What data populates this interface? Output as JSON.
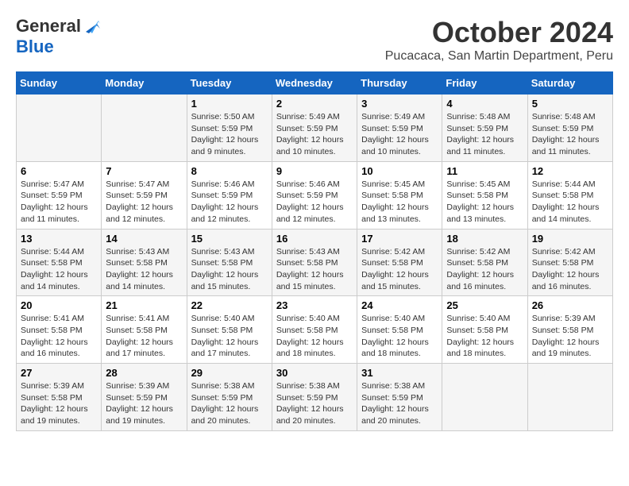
{
  "logo": {
    "general": "General",
    "blue": "Blue"
  },
  "title": "October 2024",
  "subtitle": "Pucacaca, San Martin Department, Peru",
  "headers": [
    "Sunday",
    "Monday",
    "Tuesday",
    "Wednesday",
    "Thursday",
    "Friday",
    "Saturday"
  ],
  "weeks": [
    [
      {
        "day": "",
        "info": ""
      },
      {
        "day": "",
        "info": ""
      },
      {
        "day": "1",
        "info": "Sunrise: 5:50 AM\nSunset: 5:59 PM\nDaylight: 12 hours and 9 minutes."
      },
      {
        "day": "2",
        "info": "Sunrise: 5:49 AM\nSunset: 5:59 PM\nDaylight: 12 hours and 10 minutes."
      },
      {
        "day": "3",
        "info": "Sunrise: 5:49 AM\nSunset: 5:59 PM\nDaylight: 12 hours and 10 minutes."
      },
      {
        "day": "4",
        "info": "Sunrise: 5:48 AM\nSunset: 5:59 PM\nDaylight: 12 hours and 11 minutes."
      },
      {
        "day": "5",
        "info": "Sunrise: 5:48 AM\nSunset: 5:59 PM\nDaylight: 12 hours and 11 minutes."
      }
    ],
    [
      {
        "day": "6",
        "info": "Sunrise: 5:47 AM\nSunset: 5:59 PM\nDaylight: 12 hours and 11 minutes."
      },
      {
        "day": "7",
        "info": "Sunrise: 5:47 AM\nSunset: 5:59 PM\nDaylight: 12 hours and 12 minutes."
      },
      {
        "day": "8",
        "info": "Sunrise: 5:46 AM\nSunset: 5:59 PM\nDaylight: 12 hours and 12 minutes."
      },
      {
        "day": "9",
        "info": "Sunrise: 5:46 AM\nSunset: 5:59 PM\nDaylight: 12 hours and 12 minutes."
      },
      {
        "day": "10",
        "info": "Sunrise: 5:45 AM\nSunset: 5:58 PM\nDaylight: 12 hours and 13 minutes."
      },
      {
        "day": "11",
        "info": "Sunrise: 5:45 AM\nSunset: 5:58 PM\nDaylight: 12 hours and 13 minutes."
      },
      {
        "day": "12",
        "info": "Sunrise: 5:44 AM\nSunset: 5:58 PM\nDaylight: 12 hours and 14 minutes."
      }
    ],
    [
      {
        "day": "13",
        "info": "Sunrise: 5:44 AM\nSunset: 5:58 PM\nDaylight: 12 hours and 14 minutes."
      },
      {
        "day": "14",
        "info": "Sunrise: 5:43 AM\nSunset: 5:58 PM\nDaylight: 12 hours and 14 minutes."
      },
      {
        "day": "15",
        "info": "Sunrise: 5:43 AM\nSunset: 5:58 PM\nDaylight: 12 hours and 15 minutes."
      },
      {
        "day": "16",
        "info": "Sunrise: 5:43 AM\nSunset: 5:58 PM\nDaylight: 12 hours and 15 minutes."
      },
      {
        "day": "17",
        "info": "Sunrise: 5:42 AM\nSunset: 5:58 PM\nDaylight: 12 hours and 15 minutes."
      },
      {
        "day": "18",
        "info": "Sunrise: 5:42 AM\nSunset: 5:58 PM\nDaylight: 12 hours and 16 minutes."
      },
      {
        "day": "19",
        "info": "Sunrise: 5:42 AM\nSunset: 5:58 PM\nDaylight: 12 hours and 16 minutes."
      }
    ],
    [
      {
        "day": "20",
        "info": "Sunrise: 5:41 AM\nSunset: 5:58 PM\nDaylight: 12 hours and 16 minutes."
      },
      {
        "day": "21",
        "info": "Sunrise: 5:41 AM\nSunset: 5:58 PM\nDaylight: 12 hours and 17 minutes."
      },
      {
        "day": "22",
        "info": "Sunrise: 5:40 AM\nSunset: 5:58 PM\nDaylight: 12 hours and 17 minutes."
      },
      {
        "day": "23",
        "info": "Sunrise: 5:40 AM\nSunset: 5:58 PM\nDaylight: 12 hours and 18 minutes."
      },
      {
        "day": "24",
        "info": "Sunrise: 5:40 AM\nSunset: 5:58 PM\nDaylight: 12 hours and 18 minutes."
      },
      {
        "day": "25",
        "info": "Sunrise: 5:40 AM\nSunset: 5:58 PM\nDaylight: 12 hours and 18 minutes."
      },
      {
        "day": "26",
        "info": "Sunrise: 5:39 AM\nSunset: 5:58 PM\nDaylight: 12 hours and 19 minutes."
      }
    ],
    [
      {
        "day": "27",
        "info": "Sunrise: 5:39 AM\nSunset: 5:58 PM\nDaylight: 12 hours and 19 minutes."
      },
      {
        "day": "28",
        "info": "Sunrise: 5:39 AM\nSunset: 5:59 PM\nDaylight: 12 hours and 19 minutes."
      },
      {
        "day": "29",
        "info": "Sunrise: 5:38 AM\nSunset: 5:59 PM\nDaylight: 12 hours and 20 minutes."
      },
      {
        "day": "30",
        "info": "Sunrise: 5:38 AM\nSunset: 5:59 PM\nDaylight: 12 hours and 20 minutes."
      },
      {
        "day": "31",
        "info": "Sunrise: 5:38 AM\nSunset: 5:59 PM\nDaylight: 12 hours and 20 minutes."
      },
      {
        "day": "",
        "info": ""
      },
      {
        "day": "",
        "info": ""
      }
    ]
  ]
}
